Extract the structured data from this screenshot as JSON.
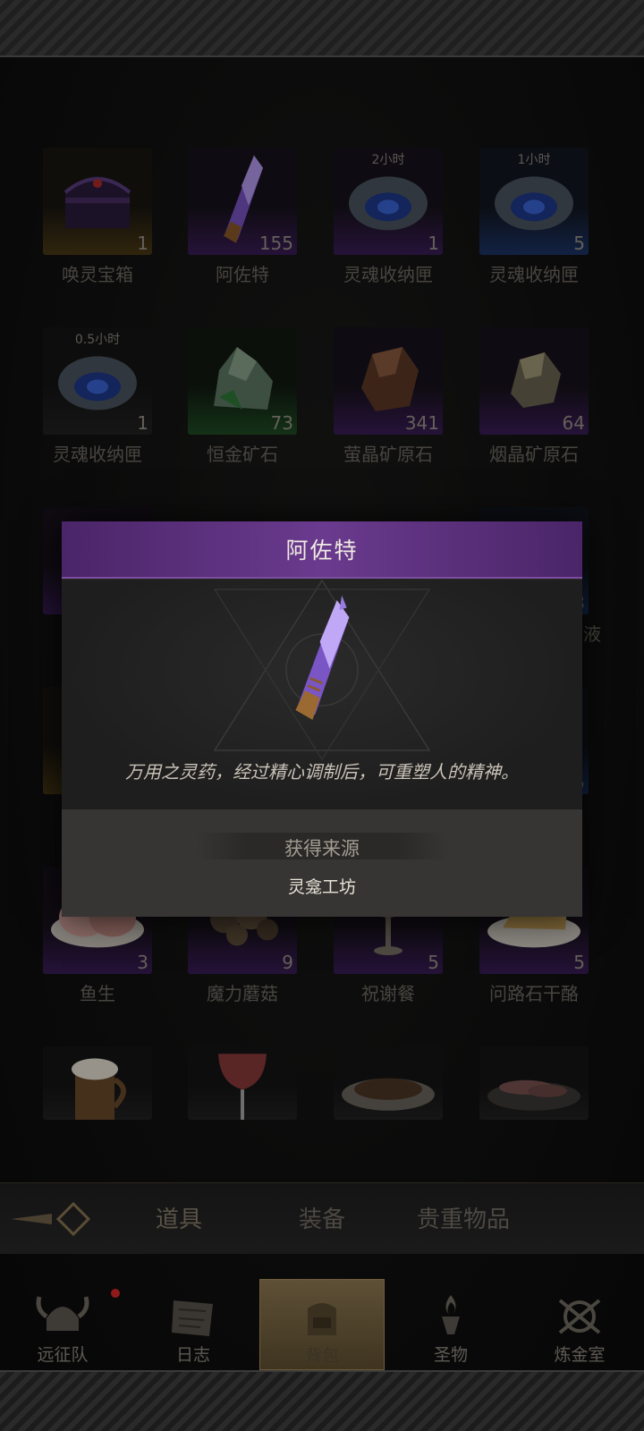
{
  "items": [
    {
      "name": "唤灵宝箱",
      "count": "1",
      "rarity": "gold",
      "icon": "chest-icon"
    },
    {
      "name": "阿佐特",
      "count": "155",
      "rarity": "purple",
      "icon": "crystal-vial-icon"
    },
    {
      "name": "灵魂收纳匣",
      "count": "1",
      "timer": "2小时",
      "rarity": "purple",
      "icon": "soul-box-icon"
    },
    {
      "name": "灵魂收纳匣",
      "count": "5",
      "timer": "1小时",
      "rarity": "blue",
      "icon": "soul-box-icon"
    },
    {
      "name": "灵魂收纳匣",
      "count": "1",
      "timer": "0.5小时",
      "rarity": "dark",
      "icon": "soul-box-icon"
    },
    {
      "name": "恒金矿石",
      "count": "73",
      "rarity": "green",
      "icon": "ore-icon"
    },
    {
      "name": "萤晶矿原石",
      "count": "341",
      "rarity": "purple",
      "icon": "amber-crystal-icon"
    },
    {
      "name": "烟晶矿原石",
      "count": "64",
      "rarity": "purple",
      "icon": "smoky-crystal-icon"
    },
    {
      "name": "鱼生",
      "count": "3",
      "rarity": "purple",
      "icon": "fish-dish-icon"
    },
    {
      "name": "魔力蘑菇",
      "count": "9",
      "rarity": "purple",
      "icon": "mushroom-icon"
    },
    {
      "name": "祝谢餐",
      "count": "5",
      "rarity": "purple",
      "icon": "goblet-icon"
    },
    {
      "name": "问路石干酪",
      "count": "5",
      "rarity": "purple",
      "icon": "cheese-icon"
    },
    {
      "name": "",
      "count": "",
      "rarity": "dark",
      "icon": "ale-mug-icon"
    },
    {
      "name": "",
      "count": "",
      "rarity": "dark",
      "icon": "wine-glass-icon"
    },
    {
      "name": "",
      "count": "",
      "rarity": "dark",
      "icon": "meat-plate-icon"
    },
    {
      "name": "",
      "count": "",
      "rarity": "dark",
      "icon": "sausage-plate-icon"
    }
  ],
  "partial_counts": {
    "row3_right": "43",
    "row4_right": "5",
    "row3_right_label": "液"
  },
  "modal": {
    "title": "阿佐特",
    "description": "万用之灵药，经过精心调制后，可重塑人的精神。",
    "source_label": "获得来源",
    "source_value": "灵龛工坊",
    "icon": "crystal-vial-icon"
  },
  "tabs": [
    {
      "label": "道具",
      "active": true
    },
    {
      "label": "装备",
      "active": false
    },
    {
      "label": "贵重物品",
      "active": false
    }
  ],
  "nav": [
    {
      "label": "远征队",
      "icon": "viking-helmet-icon",
      "badge": true
    },
    {
      "label": "日志",
      "icon": "scroll-icon",
      "badge": false
    },
    {
      "label": "背包",
      "icon": "backpack-icon",
      "active": true
    },
    {
      "label": "圣物",
      "icon": "torch-icon",
      "badge": false
    },
    {
      "label": "炼金室",
      "icon": "alchemy-icon",
      "badge": false
    }
  ],
  "colors": {
    "accent_purple": "#6a3a8e",
    "gold": "#4a3a14"
  }
}
